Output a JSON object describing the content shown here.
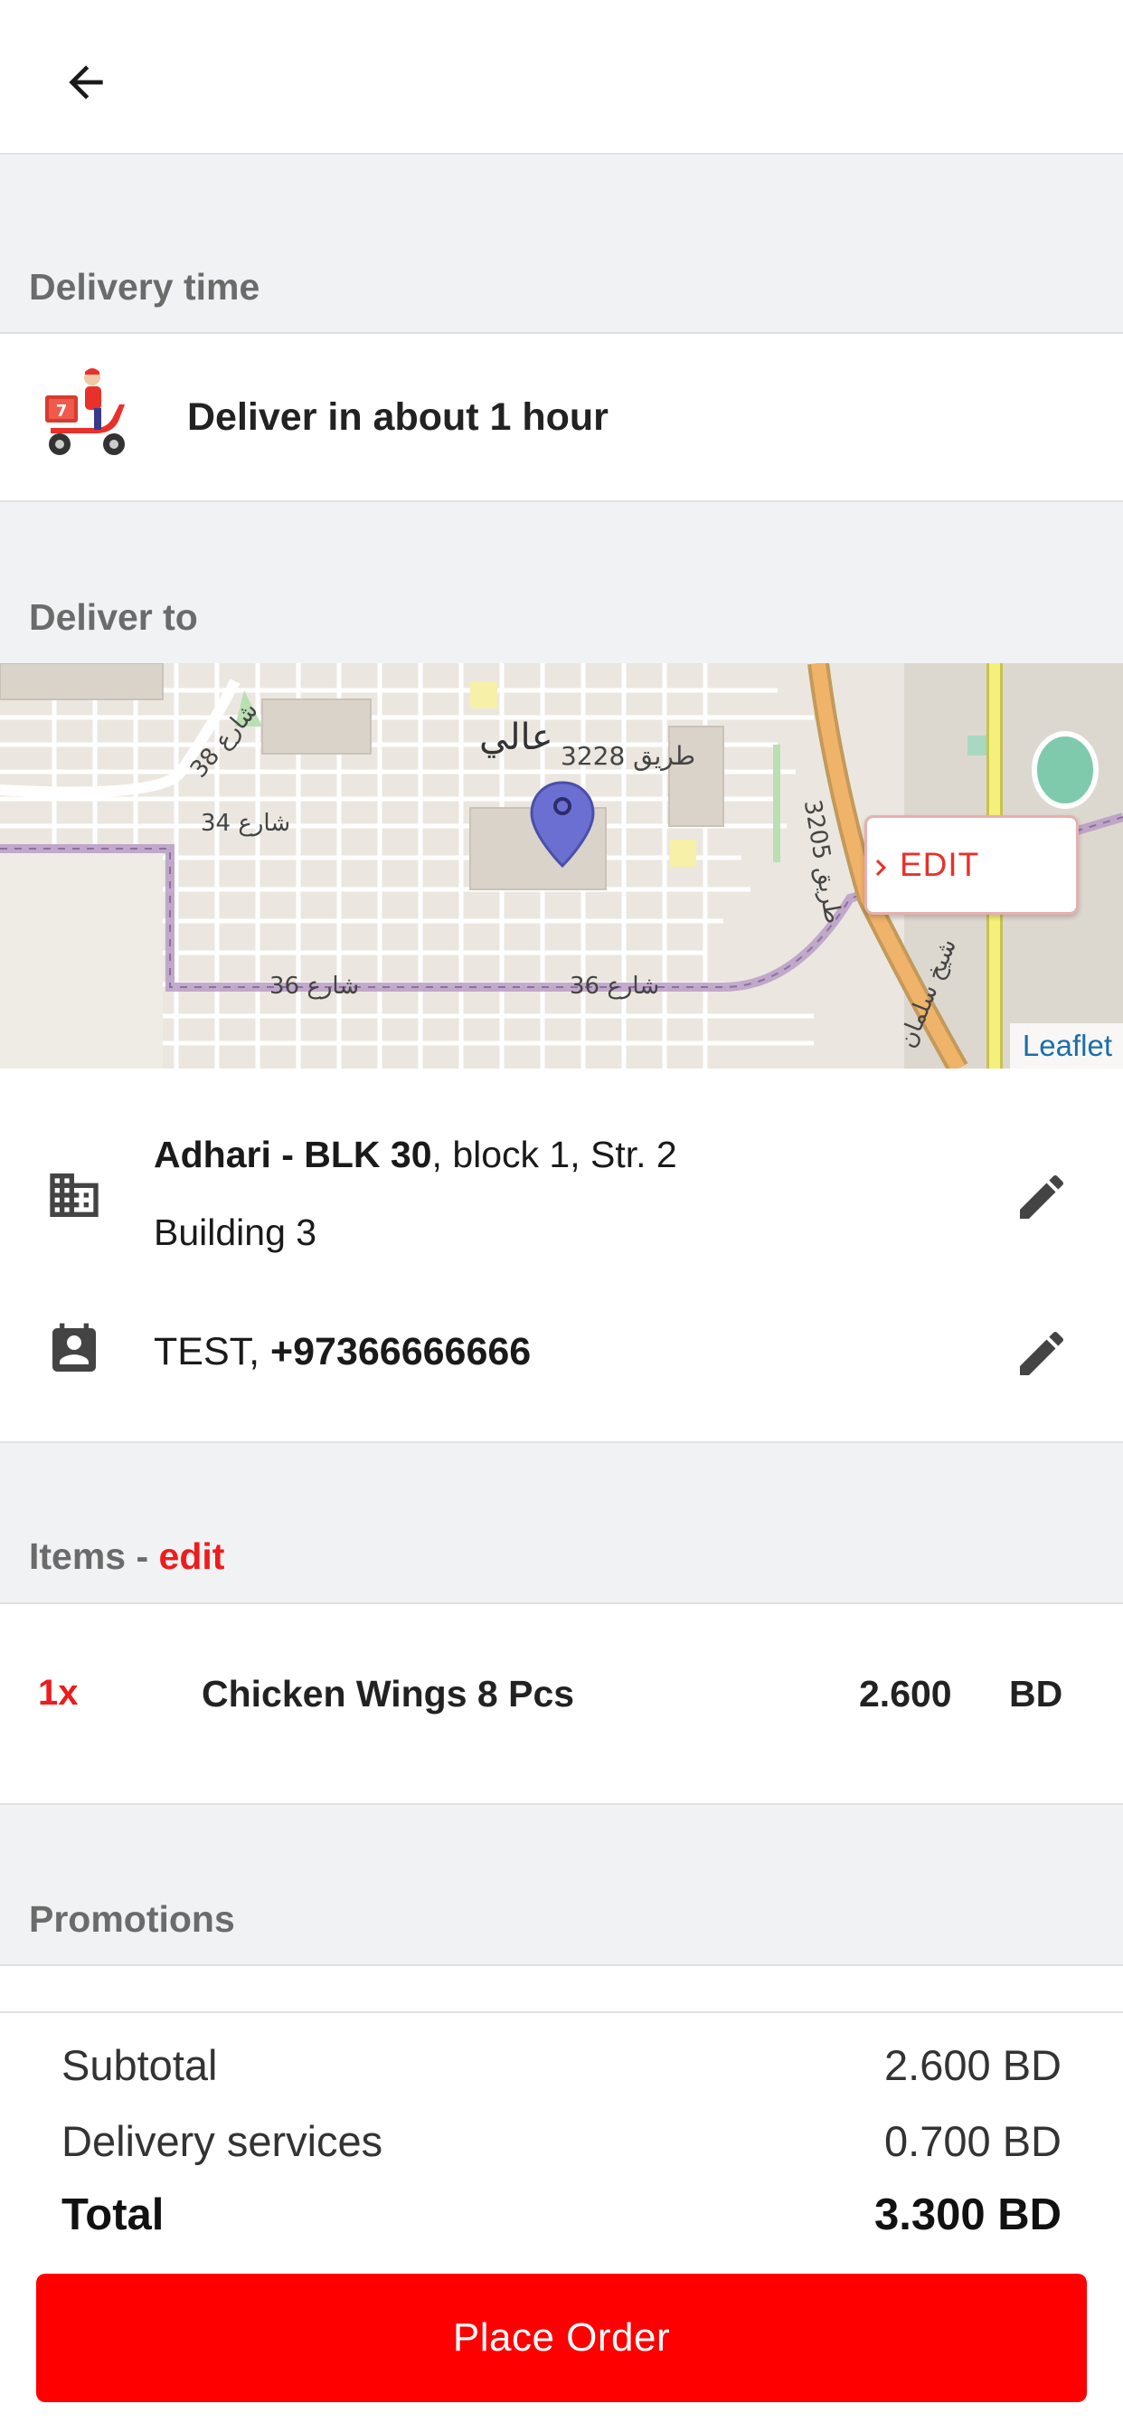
{
  "delivery_time": {
    "section_label": "Delivery time",
    "text": "Deliver in about 1 hour"
  },
  "deliver_to": {
    "section_label": "Deliver to",
    "map": {
      "edit_label": "EDIT",
      "attribution": "Leaflet",
      "labels": [
        "عالي",
        "طريق 3228",
        "طريق 3205",
        "شارع 38",
        "شارع 34",
        "شارع 36",
        "شارع 36",
        "شيخ سلمان"
      ]
    },
    "address": {
      "name_bold": "Adhari - BLK 30",
      "rest": ", block 1, Str. 2",
      "line2": "Building 3"
    },
    "contact": {
      "name": "TEST, ",
      "phone": "+97366666666"
    }
  },
  "items": {
    "label": "Items - ",
    "edit_label": "edit",
    "list": [
      {
        "qty": "1x",
        "name": "Chicken Wings 8 Pcs",
        "price": "2.600",
        "currency": "BD"
      }
    ]
  },
  "promotions": {
    "label": "Promotions"
  },
  "totals": {
    "subtotal_label": "Subtotal",
    "subtotal_value": "2.600 BD",
    "delivery_label": "Delivery services",
    "delivery_value": "0.700 BD",
    "total_label": "Total",
    "total_value": "3.300 BD"
  },
  "actions": {
    "place_order": "Place Order"
  },
  "colors": {
    "accent": "#ff0000",
    "map_pin": "#6b6fd1",
    "section_bg": "#f1f2f3"
  }
}
